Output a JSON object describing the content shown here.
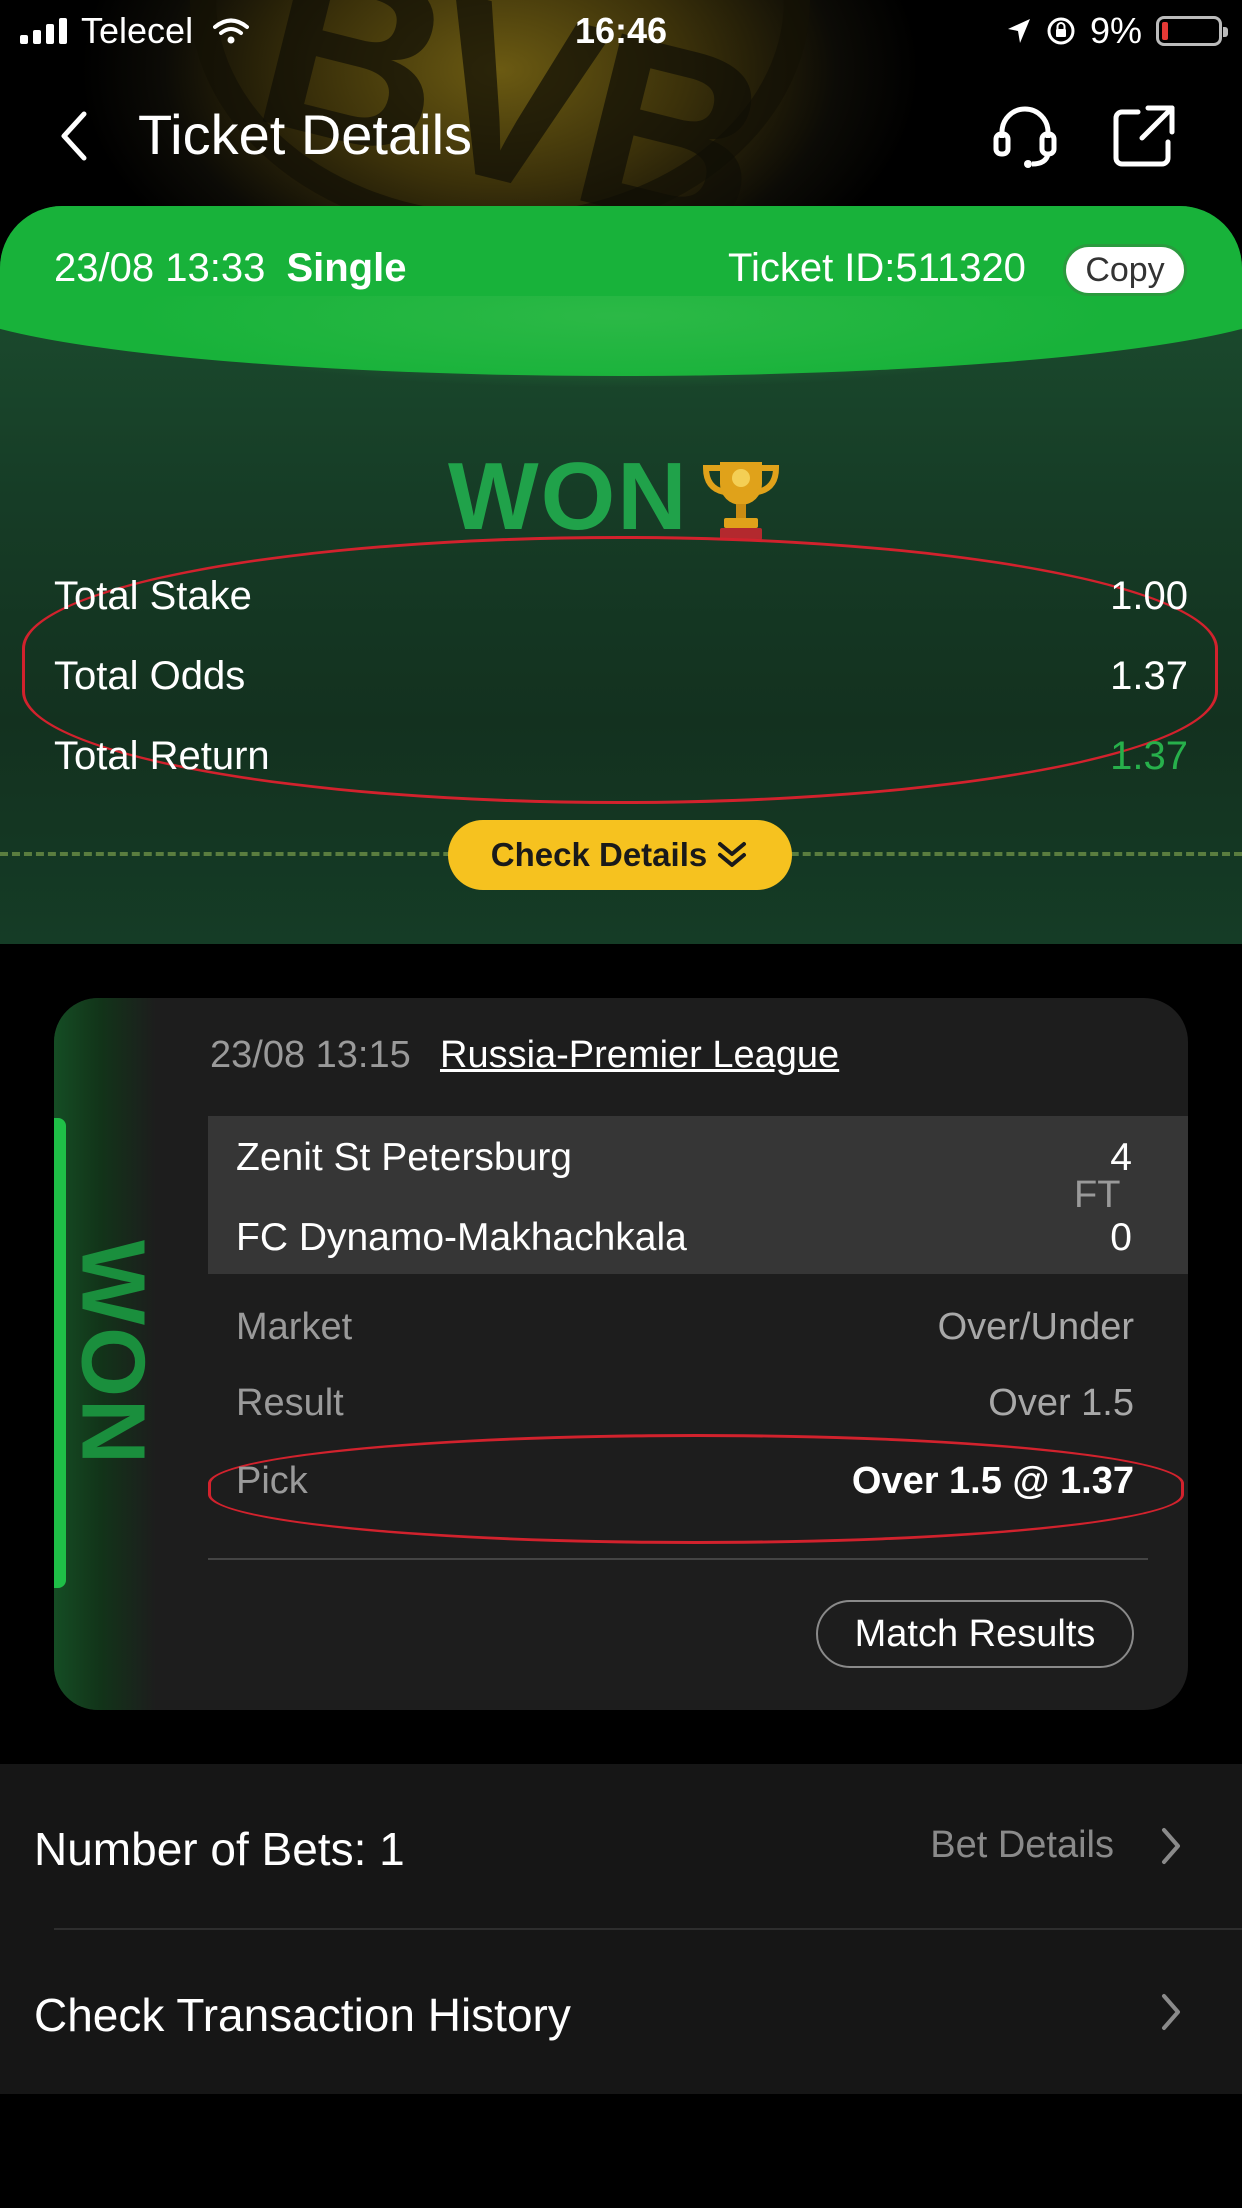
{
  "status_bar": {
    "carrier": "Telecel",
    "time": "16:46",
    "battery": "9%"
  },
  "nav": {
    "title": "Ticket Details"
  },
  "ticket": {
    "datetime": "23/08 13:33",
    "type": "Single",
    "ticket_id": "Ticket ID:511320",
    "copy_label": "Copy",
    "status": "WON",
    "total_stake_label": "Total Stake",
    "total_stake": "1.00",
    "total_odds_label": "Total Odds",
    "total_odds": "1.37",
    "total_return_label": "Total Return",
    "total_return": "1.37",
    "check_details_label": "Check Details"
  },
  "bet": {
    "side_status": "WON",
    "datetime": "23/08 13:15",
    "league": "Russia-Premier League",
    "home_team": "Zenit St Petersburg",
    "home_score": "4",
    "away_team": "FC Dynamo-Makhachkala",
    "away_score": "0",
    "match_state": "FT",
    "market_label": "Market",
    "market": "Over/Under",
    "result_label": "Result",
    "result": "Over 1.5",
    "pick_label": "Pick",
    "pick": "Over 1.5 @ 1.37",
    "match_results_label": "Match Results"
  },
  "list": {
    "bets_label": "Number of Bets: 1",
    "bet_details_label": "Bet Details",
    "history_label": "Check Transaction History"
  },
  "colors": {
    "brand_green": "#18b23a",
    "won_green": "#20a24a",
    "return_green": "#27b04b",
    "check_yellow": "#f6c21f",
    "highlight_red": "#d2222d"
  }
}
